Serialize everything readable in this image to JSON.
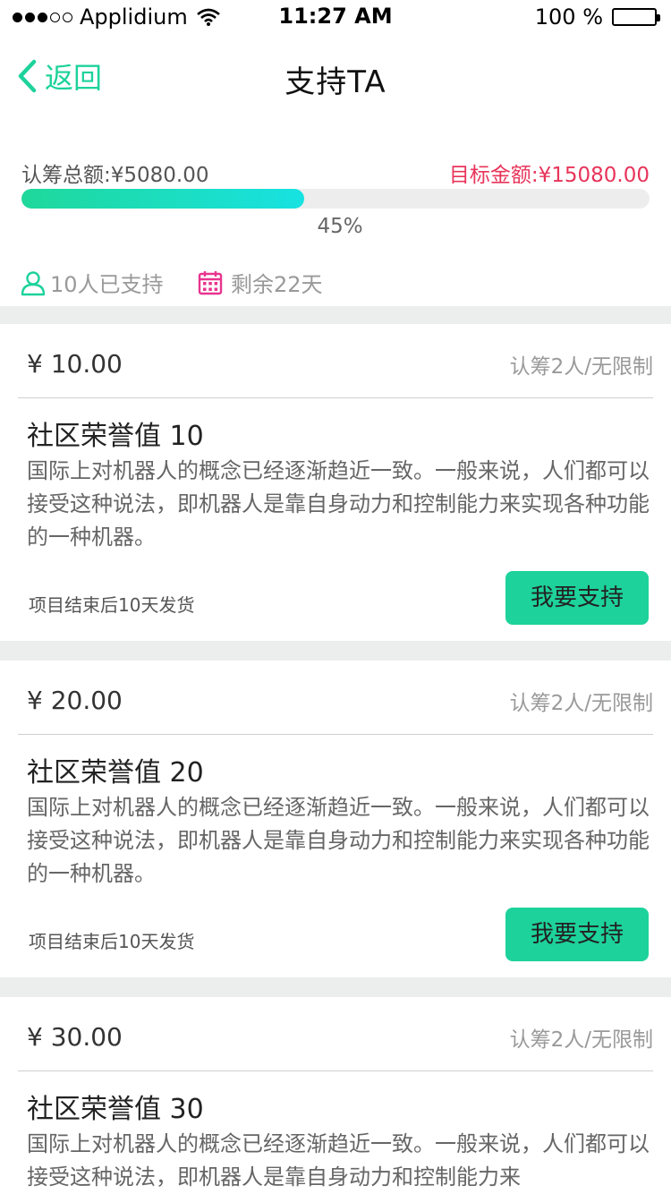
{
  "status_bar": {
    "carrier": "Applidium",
    "time": "11:27 AM",
    "battery": "100 %",
    "battery_level": 1.0
  },
  "nav": {
    "back_label": "返回",
    "title": "支持TA"
  },
  "summary": {
    "raised_label": "认筹总额:¥5080.00",
    "target_label": "目标金额:¥15080.00",
    "progress_fraction": 0.45,
    "progress_text": "45%",
    "supporters": "10人已支持",
    "remaining": "剩余22天"
  },
  "rewards": [
    {
      "price": "¥ 10.00",
      "limit": "认筹2人/无限制",
      "title": "社区荣誉值 10",
      "description": "国际上对机器人的概念已经逐渐趋近一致。一般来说，人们都可以接受这种说法，即机器人是靠自身动力和控制能力来实现各种功能的一种机器。",
      "shipping": "项目结束后10天发货",
      "button": "我要支持"
    },
    {
      "price": "¥ 20.00",
      "limit": "认筹2人/无限制",
      "title": "社区荣誉值 20",
      "description": "国际上对机器人的概念已经逐渐趋近一致。一般来说，人们都可以接受这种说法，即机器人是靠自身动力和控制能力来实现各种功能的一种机器。",
      "shipping": "项目结束后10天发货",
      "button": "我要支持"
    },
    {
      "price": "¥ 30.00",
      "limit": "认筹2人/无限制",
      "title": "社区荣誉值 30",
      "description": "国际上对机器人的概念已经逐渐趋近一致。一般来说，人们都可以接受这种说法，即机器人是靠自身动力和控制能力来",
      "shipping": "",
      "button": ""
    }
  ],
  "colors": {
    "accent": "#1dd29b",
    "target_red": "#e8345a",
    "calendar_pink": "#e8348f"
  },
  "icons": {
    "back": "chevron-left-icon",
    "supporters": "user-icon",
    "remaining": "calendar-icon"
  }
}
